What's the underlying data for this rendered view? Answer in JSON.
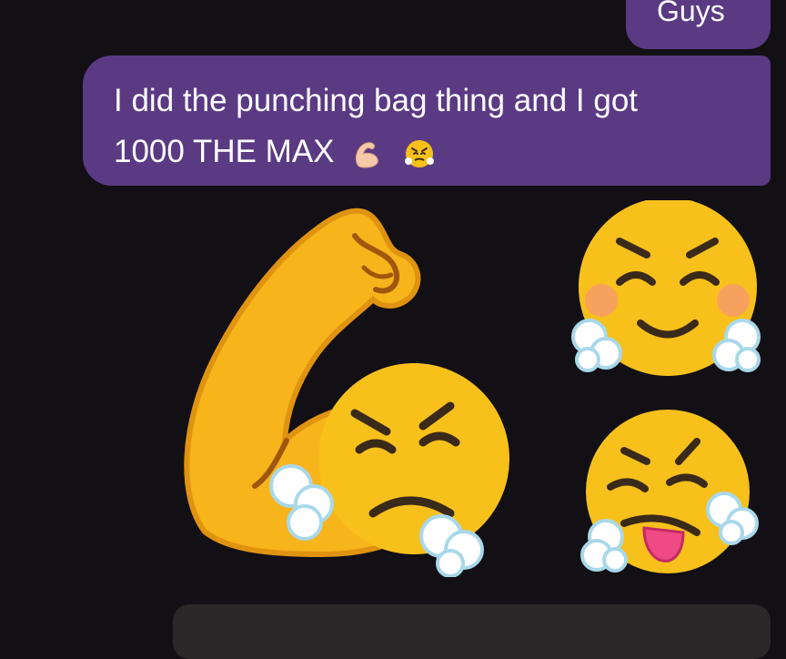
{
  "messages": [
    {
      "text": "Guys"
    },
    {
      "lines": [
        "I did the punching bag thing and I got",
        "1000 THE MAX"
      ]
    }
  ],
  "emojis": {
    "inline": [
      "flexed-biceps-icon",
      "face-with-steam-icon"
    ],
    "large": [
      "flexed-biceps-with-steam-face-sticker",
      "smiling-face-with-steam-sticker",
      "winking-tongue-face-with-steam-sticker"
    ]
  },
  "colors": {
    "background": "#121015",
    "bubble": "#5b3a84",
    "text": "#ffffff",
    "emoji_yellow": "#f7c01b"
  }
}
